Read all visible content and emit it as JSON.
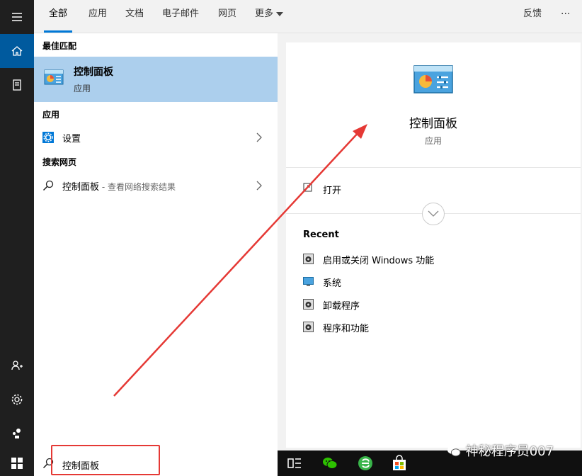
{
  "tabs": [
    {
      "label": "全部",
      "active": true
    },
    {
      "label": "应用"
    },
    {
      "label": "文档"
    },
    {
      "label": "电子邮件"
    },
    {
      "label": "网页"
    },
    {
      "label": "更多"
    }
  ],
  "header_right": {
    "feedback": "反馈",
    "more": "···"
  },
  "results": {
    "best_match_heading": "最佳匹配",
    "best_match": {
      "title": "控制面板",
      "subtitle": "应用",
      "icon": "control-panel-icon"
    },
    "apps_heading": "应用",
    "apps": [
      {
        "label": "设置",
        "icon": "gear-icon"
      }
    ],
    "web_heading": "搜索网页",
    "web": [
      {
        "label": "控制面板",
        "hint": " - 查看网络搜索结果",
        "icon": "search-icon"
      }
    ]
  },
  "preview": {
    "title": "控制面板",
    "subtitle": "应用",
    "open_label": "打开",
    "recent_heading": "Recent",
    "recent": [
      {
        "label": "启用或关闭 Windows 功能"
      },
      {
        "label": "系统"
      },
      {
        "label": "卸载程序"
      },
      {
        "label": "程序和功能"
      }
    ]
  },
  "search": {
    "value": "控制面板"
  },
  "watermark": "神秘程序员007",
  "colors": {
    "accent": "#0078d7",
    "selected": "#accfed",
    "rail": "#1f1f1f",
    "annotation": "#e53935"
  }
}
